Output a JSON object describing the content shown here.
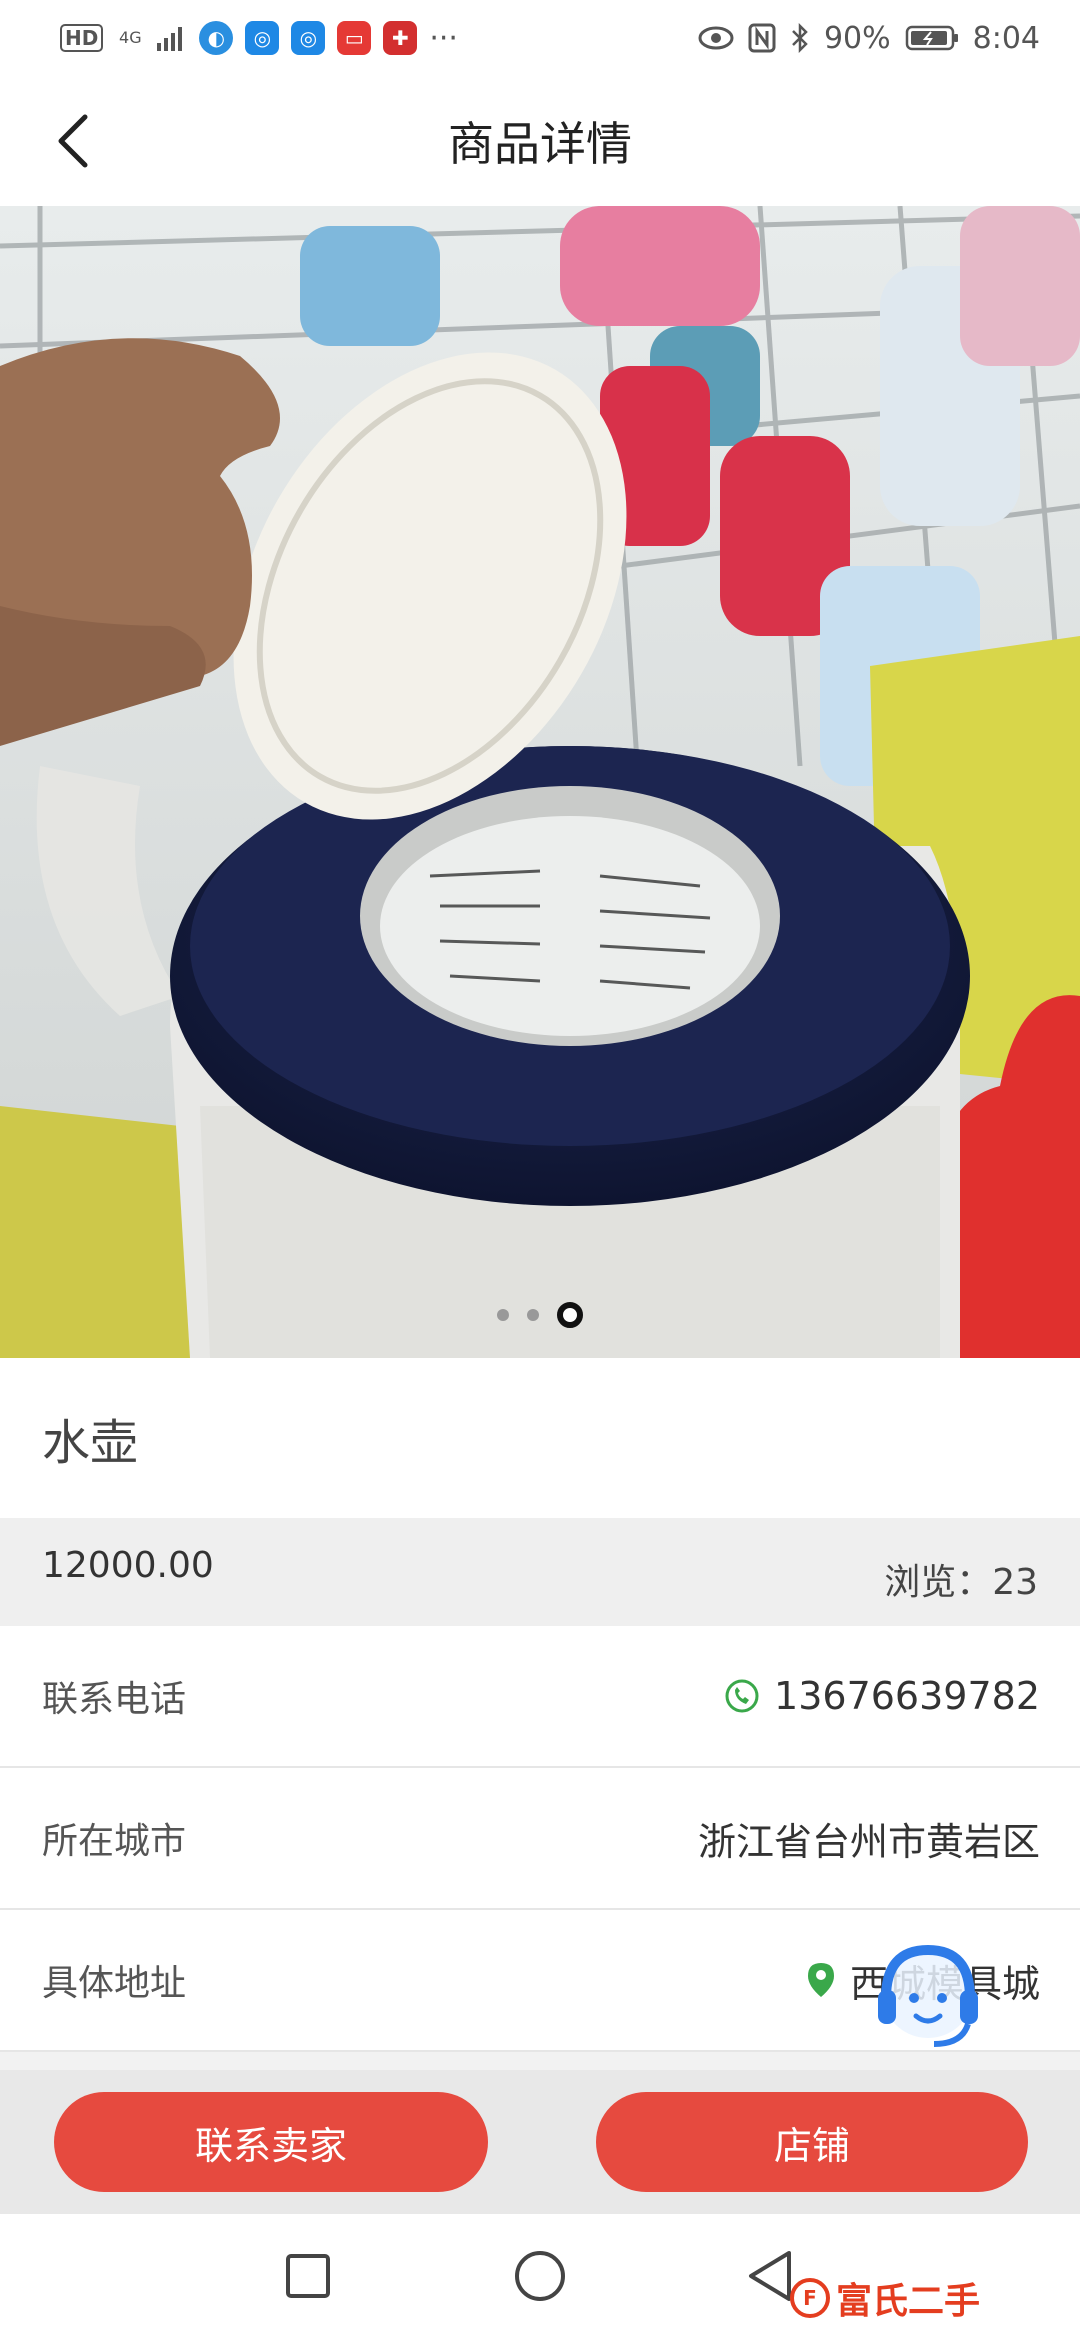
{
  "status_bar": {
    "hd": "HD",
    "network": "4G",
    "battery": "90%",
    "time": "8:04",
    "more": "···",
    "icons": [
      "hd-icon",
      "signal-icon",
      "qq-browser-icon",
      "weibo-icon",
      "weibo-icon",
      "book-icon",
      "health-app-icon",
      "eye-icon",
      "nfc-icon",
      "bluetooth-icon",
      "battery-icon"
    ]
  },
  "header": {
    "title": "商品详情",
    "back_icon": "chevron-left-icon"
  },
  "carousel": {
    "total": 3,
    "active_index": 2
  },
  "product": {
    "title": "水壶",
    "price": "12000.00",
    "views": "浏览：23"
  },
  "info": {
    "phone_label": "联系电话",
    "phone_value": "13676639782",
    "city_label": "所在城市",
    "city_value": "浙江省台州市黄岩区",
    "address_label": "具体地址",
    "address_value": "西城模具城"
  },
  "chat": {
    "label": "聊天"
  },
  "actions": {
    "contact_label": "联系卖家",
    "shop_label": "店铺"
  },
  "brand": {
    "name": "富氏二手",
    "logo_text": "F"
  },
  "colors": {
    "accent_red": "#e64a3f",
    "chat_blue": "#5b7fe6",
    "phone_green": "#3aa84a"
  }
}
